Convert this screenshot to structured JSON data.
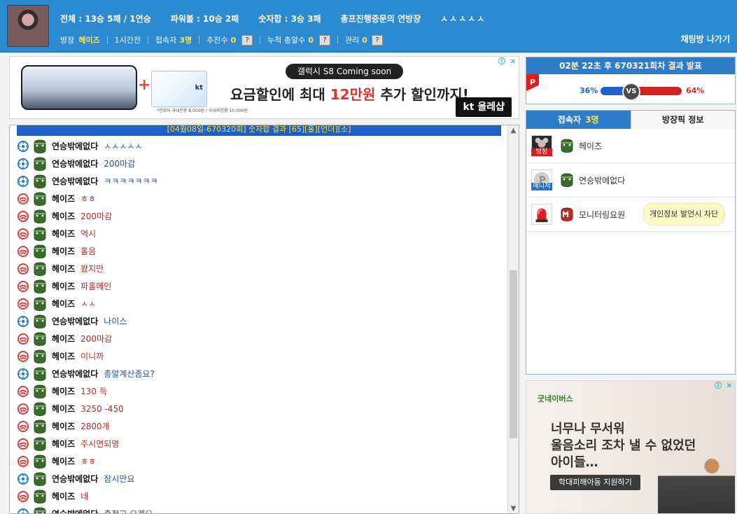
{
  "header": {
    "stats": {
      "total": "전체 : 13승 5패 / 1연승",
      "powerball": "파워볼 : 10승 2패",
      "number_sum": "숫자합 : 3승 3패",
      "room_title": "총프진행중문의 연방장",
      "emote": "ㅅㅅㅅㅅㅅ"
    },
    "room": {
      "owner_label": "방장",
      "owner_name": "헤이즈",
      "time_label": "1시간전",
      "users_label": "접속자",
      "users_value": "3명",
      "recommend_label": "추천수",
      "recommend_value": "0",
      "recommend_help": "?",
      "cumulative_label": "누적 총알수",
      "cumulative_value": "0",
      "cumulative_help": "?",
      "manage_label": "관리",
      "manage_value": "0",
      "manage_help": "?"
    },
    "leave_label": "채팅방 나가기"
  },
  "ad_top": {
    "pill": "갤럭시 S8 Coming soon",
    "headline_prefix": "요금할인에 최대 ",
    "headline_red": "12만원",
    "headline_suffix": " 추가 할인까지!",
    "fine": "*연회비 국내전용 8,000원 / 국내외겸용 10,000원",
    "card_logo": "kt",
    "brand": "kt 올레샵",
    "ad_icons": [
      "info-icon",
      "close-icon"
    ],
    "ad_info_glyph": "ⓘ",
    "ad_close_glyph": "✕"
  },
  "chat": {
    "notice": "[04월08일-670320회] 숫자합 결과 [65][홀][언더][소]",
    "messages": [
      {
        "team": "blue",
        "user": "연승밖에없다",
        "message": "ㅅㅅㅅㅅㅅ"
      },
      {
        "team": "blue",
        "user": "연승밖에없다",
        "message": "200마감"
      },
      {
        "team": "blue",
        "user": "연승밖에없다",
        "message": "ㅋㅋㅋㅋㅋㅋㅋ"
      },
      {
        "team": "red",
        "user": "헤이즈",
        "message": "ㅎㅎ"
      },
      {
        "team": "red",
        "user": "헤이즈",
        "message": "200마감"
      },
      {
        "team": "red",
        "user": "헤이즈",
        "message": "역시"
      },
      {
        "team": "red",
        "user": "헤이즈",
        "message": "홀음"
      },
      {
        "team": "red",
        "user": "헤이즈",
        "message": "봤지만"
      },
      {
        "team": "red",
        "user": "헤이즈",
        "message": "파홀메인"
      },
      {
        "team": "red",
        "user": "헤이즈",
        "message": "ㅅㅅ"
      },
      {
        "team": "blue",
        "user": "연승밖에없다",
        "message": "나이스"
      },
      {
        "team": "red",
        "user": "헤이즈",
        "message": "200마감"
      },
      {
        "team": "red",
        "user": "헤이즈",
        "message": "이니까"
      },
      {
        "team": "blue",
        "user": "연승밖에없다",
        "message": "총알계산좀요?"
      },
      {
        "team": "red",
        "user": "헤이즈",
        "message": "130 득"
      },
      {
        "team": "red",
        "user": "헤이즈",
        "message": "3250 -450"
      },
      {
        "team": "red",
        "user": "헤이즈",
        "message": "2800개"
      },
      {
        "team": "red",
        "user": "헤이즈",
        "message": "주시면되영"
      },
      {
        "team": "red",
        "user": "헤이즈",
        "message": "ㅎㅎ"
      },
      {
        "team": "blue",
        "user": "연승밖에없다",
        "message": "잠시만요"
      },
      {
        "team": "red",
        "user": "헤이즈",
        "message": "네"
      },
      {
        "team": "blue",
        "user": "연승밖에없다",
        "message": "충전고 오겠요"
      }
    ],
    "colors": {
      "blue": "#1d4fb0",
      "red": "#b32a2a"
    }
  },
  "result": {
    "title": "02분 22초 후 670321회차 결과 발표",
    "badge": "P",
    "left_pct_value": 36,
    "right_pct_value": 64,
    "left_pct_text": "36%",
    "right_pct_text": "64%",
    "vs_label": "VS",
    "colors": {
      "left": "#1f5fcf",
      "right": "#d32020"
    }
  },
  "users_panel": {
    "tab_users_label": "접속자",
    "tab_users_count": "3명",
    "tab_owner_pick_label": "방장픽 정보",
    "users": [
      {
        "role_badge": "방장",
        "name": "헤이즈"
      },
      {
        "role_badge": "매니저",
        "name": "연승밖에없다"
      },
      {
        "role_badge": "",
        "name": "모니터링요원",
        "tooltip": "개인정보 발언시 차단"
      }
    ]
  },
  "ad_bottom": {
    "brand": "굿네이버스",
    "copy_line1": "너무나 무서워",
    "copy_line2": "울음소리 조차 낼 수 없었던",
    "copy_line3": "아이들…",
    "cta": "학대피해아동 지원하기",
    "ad_icons": [
      "info-icon",
      "close-icon"
    ],
    "ad_info_glyph": "ⓘ",
    "ad_close_glyph": "✕"
  },
  "icons": {
    "team_blue": "blue-team-icon",
    "team_red": "red-team-icon",
    "rank": "rank-badge-icon",
    "monitor": "siren-icon",
    "scroll_up_glyph": "▲",
    "scroll_down_glyph": "▼"
  }
}
